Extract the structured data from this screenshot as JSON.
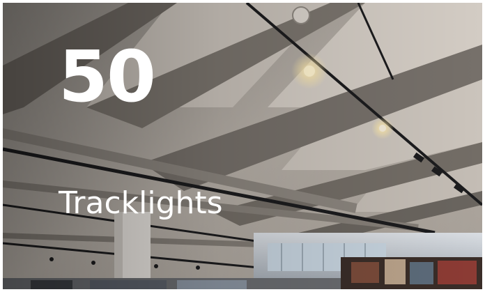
{
  "stat": {
    "number": "50",
    "label": "Tracklights"
  },
  "photo": {
    "description_icon": "ceiling-tracklights-photo"
  },
  "colors": {
    "text": "#ffffff",
    "ceiling": "#cfc8c0",
    "beam": "#6f6962",
    "track": "#1c1c1e"
  }
}
